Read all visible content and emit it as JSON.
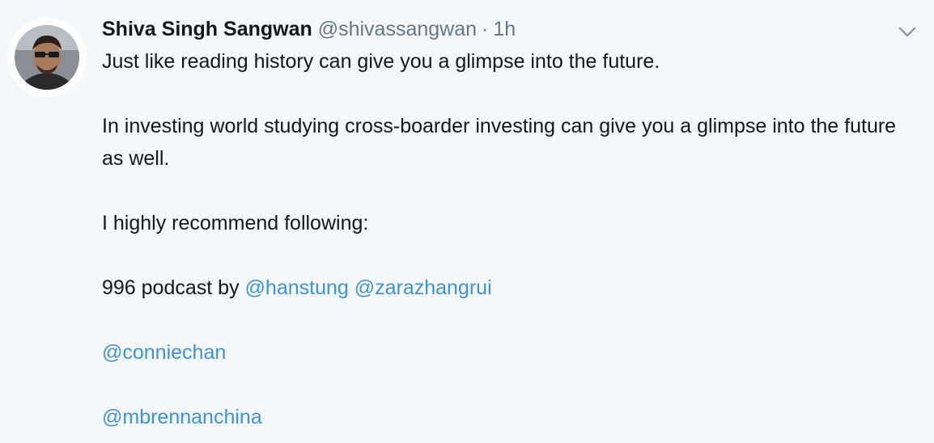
{
  "tweet": {
    "author_name": "Shiva Singh Sangwan",
    "handle": "@shivassangwan",
    "separator": "·",
    "time": "1h",
    "avatar_icon": "user-avatar-photo",
    "caret_icon": "chevron-down-icon",
    "paragraphs": {
      "p1": "Just like reading history can give you a glimpse into the future.",
      "p2": "In investing world studying cross-boarder investing can give you a glimpse into the future as well.",
      "p3": "I highly recommend following:",
      "p4_prefix": "996 podcast by",
      "p4_mention1": "@hanstung",
      "p4_mention2": "@zarazhangrui",
      "p5_mention": "@conniechan",
      "p6_mention": "@mbrennanchina"
    },
    "colors": {
      "background": "#f5f8fa",
      "text": "#14171a",
      "secondary_text": "#657786",
      "link": "#3b94d9"
    }
  }
}
